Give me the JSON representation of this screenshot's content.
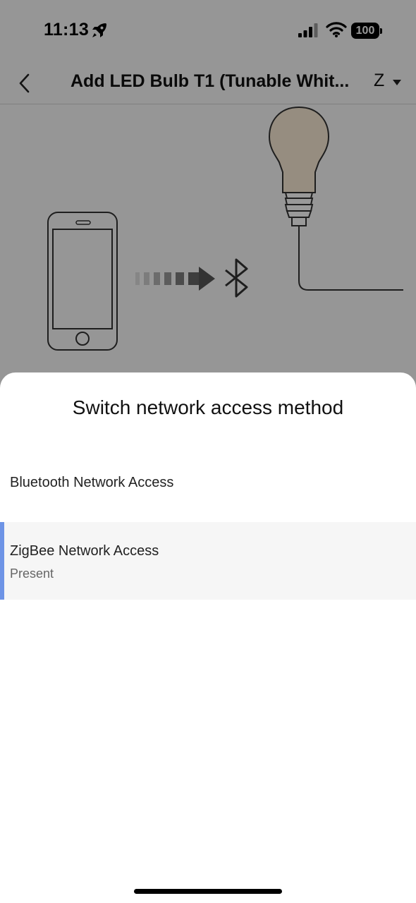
{
  "status_bar": {
    "time": "11:13",
    "battery": "100"
  },
  "nav": {
    "title": "Add LED Bulb T1 (Tunable Whit...",
    "mode": "Z",
    "icons": [
      "back-chevron-icon",
      "dropdown-arrow-icon"
    ]
  },
  "illustration": {
    "icons": [
      "phone-icon",
      "transfer-arrow-icon",
      "bluetooth-icon",
      "light-bulb-icon"
    ]
  },
  "sheet": {
    "title": "Switch network access method",
    "options": [
      {
        "label": "Bluetooth Network Access",
        "selected": false
      },
      {
        "label": "ZigBee Network Access",
        "subtitle": "Present",
        "selected": true
      }
    ]
  },
  "colors": {
    "accent": "#6e94e6",
    "dim_overlay": "rgba(0,0,0,0.40)",
    "selected_row": "#f6f6f6"
  }
}
